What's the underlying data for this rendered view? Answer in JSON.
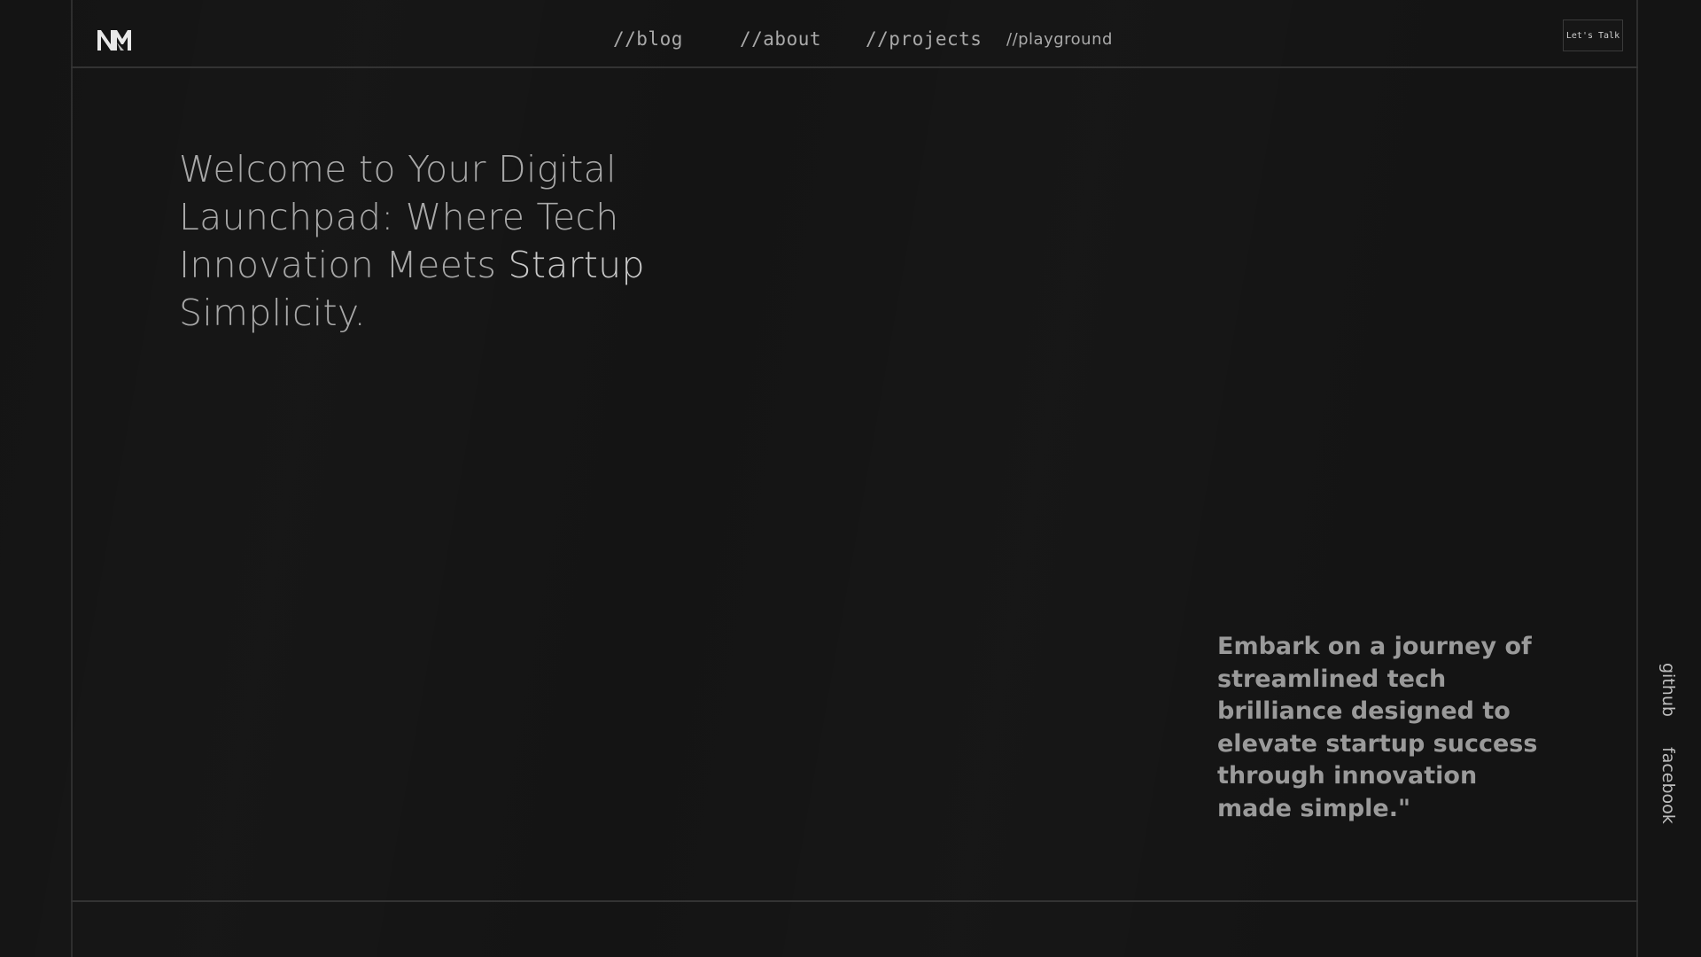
{
  "header": {
    "logo_alt": "NM",
    "nav": [
      {
        "label": "//blog"
      },
      {
        "label": "//about"
      },
      {
        "label": "//projects"
      },
      {
        "label": "//playground"
      }
    ],
    "cta_label": "Let's Talk"
  },
  "hero": {
    "line1": "Welcome to Your Digital",
    "line2": "Launchpad: Where Tech",
    "line3a": "Innovation Meets ",
    "line3b": "Startup",
    "line4": "Simplicity."
  },
  "tagline": "Embark on a journey of streamlined tech brilliance designed to elevate startup success through innovation made simple.\"",
  "social": {
    "github": "github",
    "facebook": "facebook"
  },
  "colors": {
    "background": "#141414",
    "frame": "#2e2e2e",
    "text_primary": "#a8a8a8"
  }
}
